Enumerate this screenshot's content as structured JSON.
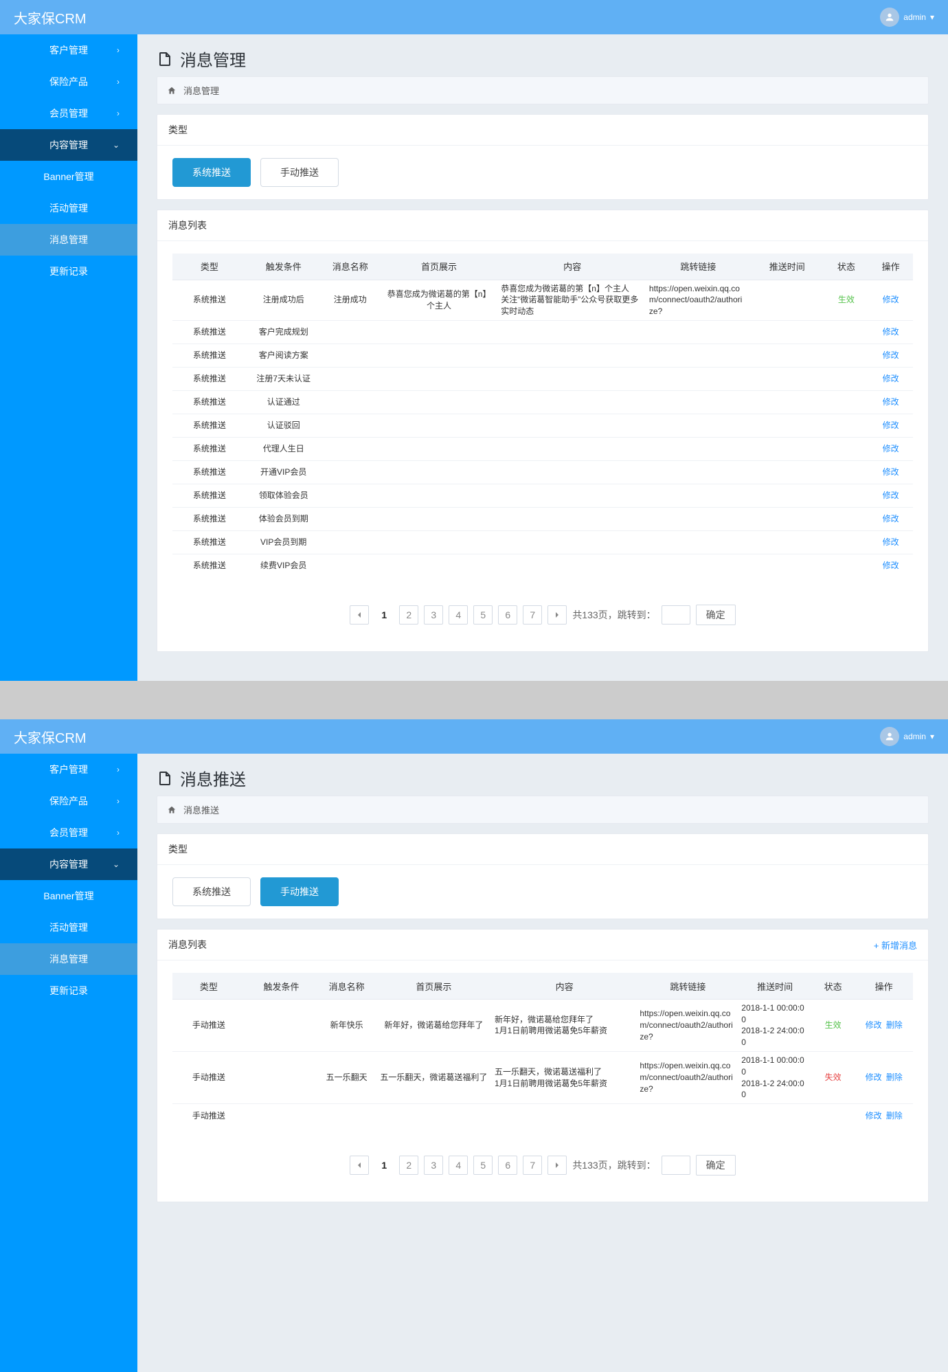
{
  "app": {
    "brand": "大家保CRM",
    "username": "admin"
  },
  "sidebar": {
    "top_items": [
      {
        "label": "客户管理"
      },
      {
        "label": "保险产品"
      },
      {
        "label": "会员管理"
      }
    ],
    "open_item": {
      "label": "内容管理"
    },
    "sub_items": [
      {
        "label": "Banner管理"
      },
      {
        "label": "活动管理"
      },
      {
        "label": "消息管理"
      },
      {
        "label": "更新记录"
      }
    ]
  },
  "screens": {
    "a": {
      "title": "消息管理",
      "crumb": "消息管理",
      "type_label": "类型",
      "tabs": {
        "system": "系统推送",
        "manual": "手动推送"
      },
      "list_label": "消息列表",
      "columns": {
        "type": "类型",
        "trigger": "触发条件",
        "name": "消息名称",
        "home": "首页展示",
        "content": "内容",
        "link": "跳转链接",
        "time": "推送时间",
        "status": "状态",
        "op": "操作"
      },
      "op_edit": "修改",
      "rows": [
        {
          "type": "系统推送",
          "trigger": "注册成功后",
          "name": "注册成功",
          "home": "恭喜您成为微诺葛的第【n】个主人",
          "content": "恭喜您成为微诺葛的第【n】个主人\n关注“微诺葛智能助手”公众号获取更多实时动态",
          "link": "https://open.weixin.qq.com/connect/oauth2/authorize?",
          "time": "",
          "status": "生效"
        },
        {
          "type": "系统推送",
          "trigger": "客户完成规划"
        },
        {
          "type": "系统推送",
          "trigger": "客户阅读方案"
        },
        {
          "type": "系统推送",
          "trigger": "注册7天未认证"
        },
        {
          "type": "系统推送",
          "trigger": "认证通过"
        },
        {
          "type": "系统推送",
          "trigger": "认证驳回"
        },
        {
          "type": "系统推送",
          "trigger": "代理人生日"
        },
        {
          "type": "系统推送",
          "trigger": "开通VIP会员"
        },
        {
          "type": "系统推送",
          "trigger": "领取体验会员"
        },
        {
          "type": "系统推送",
          "trigger": "体验会员到期"
        },
        {
          "type": "系统推送",
          "trigger": "VIP会员到期"
        },
        {
          "type": "系统推送",
          "trigger": "续费VIP会员"
        }
      ]
    },
    "b": {
      "title": "消息推送",
      "crumb": "消息推送",
      "type_label": "类型",
      "tabs": {
        "system": "系统推送",
        "manual": "手动推送"
      },
      "list_label": "消息列表",
      "add_label": "+ 新增消息",
      "columns": {
        "type": "类型",
        "trigger": "触发条件",
        "name": "消息名称",
        "home": "首页展示",
        "content": "内容",
        "link": "跳转链接",
        "time": "推送时间",
        "status": "状态",
        "op": "操作"
      },
      "op_edit": "修改",
      "op_delete": "删除",
      "rows": [
        {
          "type": "手动推送",
          "trigger": "",
          "name": "新年快乐",
          "home": "新年好，微诺葛给您拜年了",
          "content": "新年好，微诺葛给您拜年了\n1月1日前聘用微诺葛免5年薪资",
          "link": "https://open.weixin.qq.com/connect/oauth2/authorize?",
          "time": "2018-1-1 00:00:00\n2018-1-2 24:00:00",
          "status": "生效"
        },
        {
          "type": "手动推送",
          "trigger": "",
          "name": "五一乐翻天",
          "home": "五一乐翻天，微诺葛送福利了",
          "content": "五一乐翻天，微诺葛送福利了\n1月1日前聘用微诺葛免5年薪资",
          "link": "https://open.weixin.qq.com/connect/oauth2/authorize?",
          "time": "2018-1-1 00:00:00\n2018-1-2 24:00:00",
          "status": "失效"
        },
        {
          "type": "手动推送"
        }
      ]
    }
  },
  "pager": {
    "pages": [
      "1",
      "2",
      "3",
      "4",
      "5",
      "6",
      "7"
    ],
    "total_text_prefix": "共",
    "total_text_mid": "页，跳转到：",
    "total_pages": "133",
    "confirm": "确定"
  }
}
